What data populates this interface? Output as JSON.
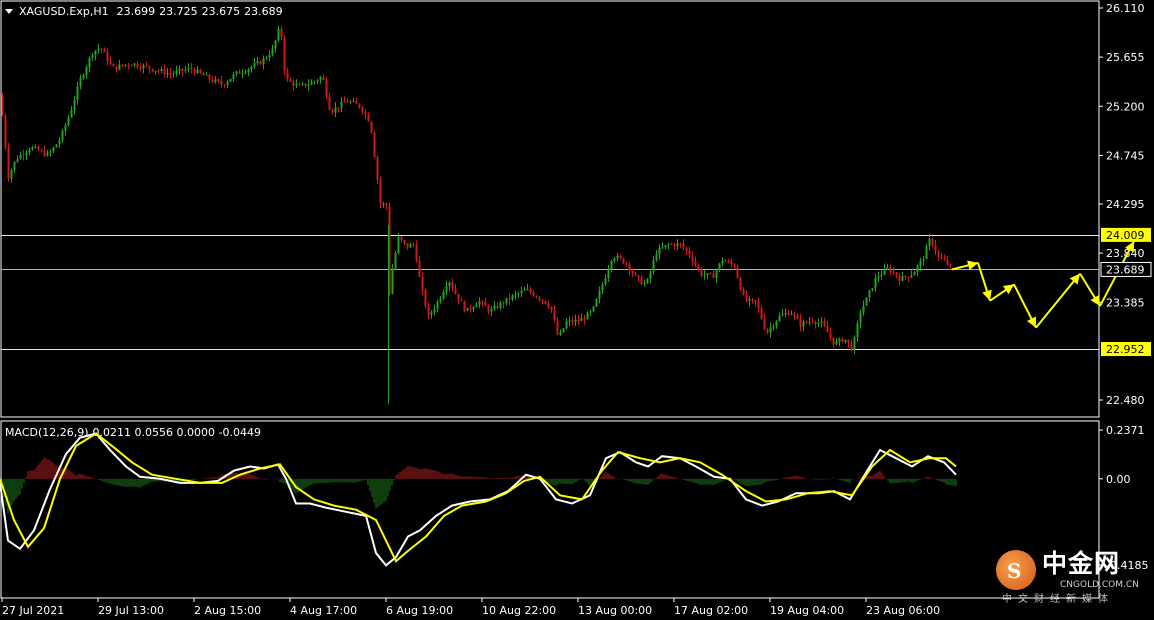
{
  "header": {
    "symbol": "XAGUSD.Exp,H1",
    "open": "23.699",
    "high": "23.725",
    "low": "23.675",
    "close": "23.689"
  },
  "macd_header": {
    "name": "MACD(12,26,9)",
    "values": "0.0211 0.0556 0.0000 -0.0449"
  },
  "watermark": {
    "cn": "中金网",
    "en": "CNGOLD.COM.CN",
    "sub": "中文财经新媒体"
  },
  "colors": {
    "background": "#000000",
    "grid": "#ffffff",
    "bull": "#1fa51f",
    "bear": "#d01a1a",
    "level_line": "#f2f2a0",
    "price_line": "#a8b4c8",
    "macd_line": "#ffffff",
    "signal_line": "#ffff00",
    "hist_pos": "#b42020",
    "hist_neg": "#1e7a1e",
    "arrow": "#ffff00",
    "label_bg": "#ffff00"
  },
  "chart_data": {
    "type": "candlestick",
    "price_axis": {
      "ticks": [
        26.11,
        25.655,
        25.2,
        24.745,
        24.295,
        23.84,
        23.385,
        22.48
      ],
      "tick_labels": [
        "26.110",
        "25.655",
        "25.200",
        "24.745",
        "24.295",
        "23.840",
        "23.385",
        "22.480"
      ]
    },
    "macd_axis": {
      "ticks": [
        0.2371,
        0.0,
        -0.4185
      ],
      "tick_labels": [
        "0.2371",
        "0.00",
        "-0.4185"
      ]
    },
    "time_axis": {
      "labels": [
        "27 Jul 2021",
        "29 Jul 13:00",
        "2 Aug 15:00",
        "4 Aug 17:00",
        "6 Aug 19:00",
        "10 Aug 22:00",
        "13 Aug 00:00",
        "17 Aug 02:00",
        "19 Aug 04:00",
        "23 Aug 06:00"
      ]
    },
    "levels": [
      {
        "value": 24.009,
        "label": "24.009"
      },
      {
        "value": 22.952,
        "label": "22.952"
      }
    ],
    "current_price": {
      "value": 23.689,
      "label": "23.689"
    },
    "price_path": [
      [
        0,
        25.3
      ],
      [
        8,
        24.55
      ],
      [
        16,
        24.72
      ],
      [
        30,
        24.82
      ],
      [
        48,
        24.75
      ],
      [
        60,
        24.9
      ],
      [
        70,
        25.15
      ],
      [
        80,
        25.45
      ],
      [
        92,
        25.7
      ],
      [
        100,
        25.75
      ],
      [
        112,
        25.55
      ],
      [
        130,
        25.6
      ],
      [
        150,
        25.55
      ],
      [
        170,
        25.5
      ],
      [
        190,
        25.55
      ],
      [
        210,
        25.45
      ],
      [
        222,
        25.4
      ],
      [
        235,
        25.5
      ],
      [
        248,
        25.55
      ],
      [
        262,
        25.62
      ],
      [
        272,
        25.72
      ],
      [
        280,
        25.95
      ],
      [
        285,
        25.45
      ],
      [
        298,
        25.38
      ],
      [
        312,
        25.42
      ],
      [
        322,
        25.48
      ],
      [
        330,
        25.15
      ],
      [
        346,
        25.25
      ],
      [
        360,
        25.2
      ],
      [
        370,
        25.05
      ],
      [
        376,
        24.6
      ],
      [
        380,
        24.3
      ],
      [
        386,
        24.28
      ],
      [
        388,
        23.4
      ],
      [
        392,
        23.7
      ],
      [
        398,
        23.98
      ],
      [
        406,
        23.9
      ],
      [
        414,
        23.92
      ],
      [
        420,
        23.55
      ],
      [
        428,
        23.25
      ],
      [
        438,
        23.4
      ],
      [
        448,
        23.6
      ],
      [
        456,
        23.45
      ],
      [
        466,
        23.3
      ],
      [
        478,
        23.4
      ],
      [
        490,
        23.3
      ],
      [
        502,
        23.38
      ],
      [
        514,
        23.45
      ],
      [
        526,
        23.5
      ],
      [
        540,
        23.42
      ],
      [
        550,
        23.35
      ],
      [
        558,
        23.05
      ],
      [
        566,
        23.2
      ],
      [
        580,
        23.22
      ],
      [
        592,
        23.3
      ],
      [
        604,
        23.6
      ],
      [
        612,
        23.82
      ],
      [
        626,
        23.75
      ],
      [
        636,
        23.6
      ],
      [
        646,
        23.55
      ],
      [
        656,
        23.85
      ],
      [
        668,
        23.92
      ],
      [
        680,
        23.92
      ],
      [
        690,
        23.82
      ],
      [
        700,
        23.65
      ],
      [
        712,
        23.62
      ],
      [
        722,
        23.78
      ],
      [
        734,
        23.72
      ],
      [
        744,
        23.4
      ],
      [
        756,
        23.38
      ],
      [
        766,
        23.1
      ],
      [
        778,
        23.25
      ],
      [
        790,
        23.3
      ],
      [
        800,
        23.18
      ],
      [
        812,
        23.22
      ],
      [
        822,
        23.18
      ],
      [
        834,
        23.0
      ],
      [
        844,
        23.05
      ],
      [
        852,
        22.95
      ],
      [
        860,
        23.3
      ],
      [
        868,
        23.45
      ],
      [
        876,
        23.62
      ],
      [
        888,
        23.7
      ],
      [
        900,
        23.6
      ],
      [
        912,
        23.65
      ],
      [
        922,
        23.78
      ],
      [
        930,
        23.98
      ],
      [
        938,
        23.8
      ],
      [
        946,
        23.75
      ],
      [
        952,
        23.69
      ]
    ],
    "macd_path": [
      [
        0,
        -0.02
      ],
      [
        8,
        -0.3
      ],
      [
        20,
        -0.34
      ],
      [
        34,
        -0.25
      ],
      [
        50,
        -0.05
      ],
      [
        66,
        0.12
      ],
      [
        80,
        0.2
      ],
      [
        96,
        0.22
      ],
      [
        110,
        0.14
      ],
      [
        126,
        0.06
      ],
      [
        140,
        0.01
      ],
      [
        160,
        0.0
      ],
      [
        180,
        -0.02
      ],
      [
        200,
        -0.02
      ],
      [
        218,
        -0.01
      ],
      [
        234,
        0.04
      ],
      [
        250,
        0.06
      ],
      [
        264,
        0.05
      ],
      [
        278,
        0.07
      ],
      [
        286,
        0.0
      ],
      [
        296,
        -0.12
      ],
      [
        310,
        -0.12
      ],
      [
        326,
        -0.14
      ],
      [
        346,
        -0.16
      ],
      [
        366,
        -0.18
      ],
      [
        376,
        -0.36
      ],
      [
        386,
        -0.42
      ],
      [
        396,
        -0.38
      ],
      [
        408,
        -0.28
      ],
      [
        420,
        -0.25
      ],
      [
        436,
        -0.18
      ],
      [
        452,
        -0.13
      ],
      [
        470,
        -0.11
      ],
      [
        490,
        -0.1
      ],
      [
        508,
        -0.06
      ],
      [
        526,
        0.02
      ],
      [
        540,
        0.0
      ],
      [
        556,
        -0.1
      ],
      [
        572,
        -0.12
      ],
      [
        590,
        -0.08
      ],
      [
        606,
        0.1
      ],
      [
        620,
        0.13
      ],
      [
        636,
        0.08
      ],
      [
        648,
        0.06
      ],
      [
        662,
        0.11
      ],
      [
        680,
        0.1
      ],
      [
        696,
        0.06
      ],
      [
        714,
        0.01
      ],
      [
        730,
        0.0
      ],
      [
        746,
        -0.1
      ],
      [
        762,
        -0.13
      ],
      [
        778,
        -0.11
      ],
      [
        796,
        -0.07
      ],
      [
        818,
        -0.07
      ],
      [
        834,
        -0.06
      ],
      [
        850,
        -0.1
      ],
      [
        866,
        0.03
      ],
      [
        880,
        0.14
      ],
      [
        896,
        0.1
      ],
      [
        912,
        0.06
      ],
      [
        928,
        0.11
      ],
      [
        944,
        0.08
      ],
      [
        956,
        0.02
      ]
    ],
    "signal_path": [
      [
        0,
        0.0
      ],
      [
        14,
        -0.2
      ],
      [
        28,
        -0.33
      ],
      [
        44,
        -0.24
      ],
      [
        60,
        0.0
      ],
      [
        76,
        0.16
      ],
      [
        96,
        0.22
      ],
      [
        112,
        0.16
      ],
      [
        132,
        0.08
      ],
      [
        152,
        0.02
      ],
      [
        176,
        0.0
      ],
      [
        200,
        -0.02
      ],
      [
        222,
        -0.02
      ],
      [
        240,
        0.02
      ],
      [
        260,
        0.05
      ],
      [
        280,
        0.07
      ],
      [
        296,
        -0.04
      ],
      [
        314,
        -0.1
      ],
      [
        334,
        -0.13
      ],
      [
        356,
        -0.15
      ],
      [
        376,
        -0.2
      ],
      [
        396,
        -0.4
      ],
      [
        408,
        -0.35
      ],
      [
        426,
        -0.28
      ],
      [
        444,
        -0.18
      ],
      [
        462,
        -0.13
      ],
      [
        486,
        -0.11
      ],
      [
        506,
        -0.07
      ],
      [
        524,
        -0.01
      ],
      [
        540,
        0.01
      ],
      [
        560,
        -0.08
      ],
      [
        582,
        -0.1
      ],
      [
        602,
        0.04
      ],
      [
        618,
        0.13
      ],
      [
        640,
        0.1
      ],
      [
        660,
        0.08
      ],
      [
        680,
        0.1
      ],
      [
        700,
        0.08
      ],
      [
        722,
        0.02
      ],
      [
        746,
        -0.06
      ],
      [
        766,
        -0.11
      ],
      [
        786,
        -0.1
      ],
      [
        808,
        -0.07
      ],
      [
        830,
        -0.06
      ],
      [
        852,
        -0.08
      ],
      [
        872,
        0.06
      ],
      [
        890,
        0.14
      ],
      [
        910,
        0.08
      ],
      [
        930,
        0.1
      ],
      [
        946,
        0.1
      ],
      [
        956,
        0.06
      ]
    ],
    "forecast_path": [
      [
        952,
        23.689
      ],
      [
        978,
        23.75
      ],
      [
        990,
        23.4
      ],
      [
        1014,
        23.55
      ],
      [
        1036,
        23.15
      ],
      [
        1080,
        23.65
      ],
      [
        1100,
        23.35
      ],
      [
        1134,
        23.95
      ]
    ]
  }
}
